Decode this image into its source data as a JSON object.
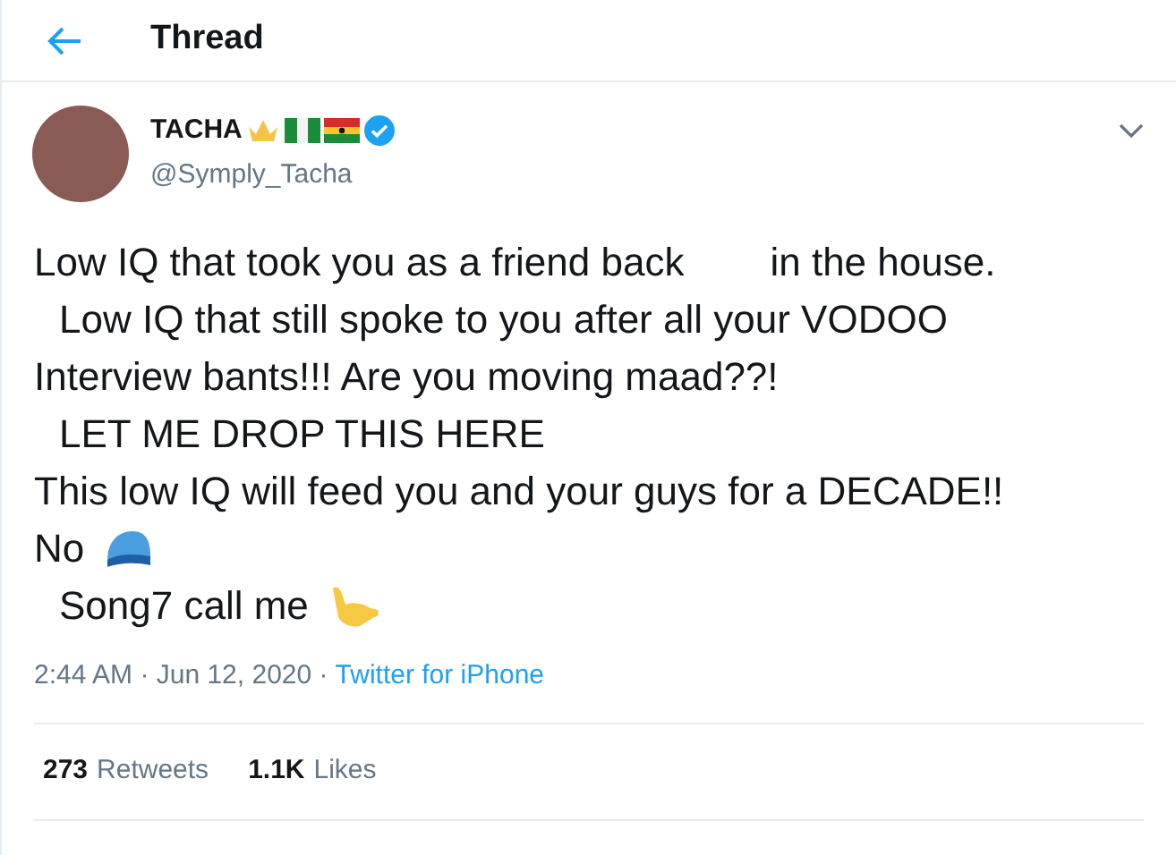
{
  "header": {
    "title": "Thread"
  },
  "tweet": {
    "name": "TACHA",
    "handle": "@Symply_Tacha",
    "verified": true,
    "lines": [
      {
        "kind": "text",
        "parts": [
          "Low IQ that took you as a friend back",
          "in the house."
        ],
        "indent": false
      },
      {
        "kind": "text",
        "parts": [
          "Low IQ that still spoke to you after all your VODOO"
        ],
        "indent": true
      },
      {
        "kind": "text",
        "parts": [
          "Interview bants!!! Are you moving maad??!"
        ],
        "indent": false
      },
      {
        "kind": "text",
        "parts": [
          "LET ME DROP THIS HERE"
        ],
        "indent": true
      },
      {
        "kind": "text",
        "parts": [
          "This low IQ will feed you and your guys for a DECADE!!"
        ],
        "indent": false
      },
      {
        "kind": "cap",
        "parts": [
          "No"
        ],
        "indent": false
      },
      {
        "kind": "hand",
        "parts": [
          "Song7 call me"
        ],
        "indent": true
      }
    ],
    "time": "2:44 AM · Jun 12, 2020 ·",
    "source": "Twitter for iPhone",
    "stats": [
      {
        "count": "273",
        "label": "Retweets"
      },
      {
        "count": "1.1K",
        "label": "Likes"
      }
    ]
  }
}
